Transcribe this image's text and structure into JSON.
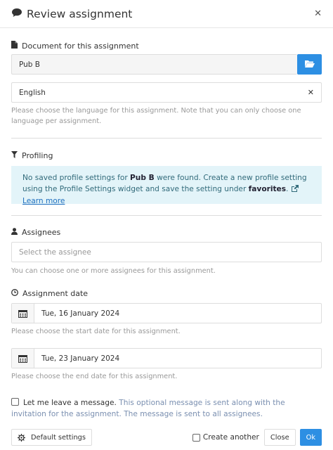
{
  "dialog": {
    "title": "Review assignment",
    "title_icon": "comment-icon",
    "close_icon": "close-icon"
  },
  "document": {
    "label": "Document for this assignment",
    "label_icon": "file-icon",
    "value": "Pub B",
    "browse_icon": "folder-open-icon"
  },
  "language": {
    "value": "English",
    "clear_icon": "close-icon",
    "hint": "Please choose the language for this assignment. Note that you can only choose one language per assignment."
  },
  "profiling": {
    "label": "Profiling",
    "label_icon": "filter-icon",
    "info": {
      "text_before": "No saved profile settings for ",
      "doc_name": "Pub B",
      "text_middle": " were found. Create a new profile setting using the Profile Settings widget and save the setting under ",
      "favorites": "favorites",
      "text_after": ". ",
      "learn_more": "Learn more",
      "external_icon": "external-link-icon"
    }
  },
  "assignees": {
    "label": "Assignees",
    "label_icon": "user-icon",
    "placeholder": "Select the assignee",
    "hint": "You can choose one or more assignees for this assignment."
  },
  "assignment_date": {
    "label": "Assignment date",
    "label_icon": "clock-icon",
    "start_value": "Tue, 16 January 2024",
    "start_hint": "Please choose the start date for this assignment.",
    "end_value": "Tue, 23 January 2024",
    "end_hint": "Please choose the end date for this assignment.",
    "calendar_icon": "calendar-icon"
  },
  "message": {
    "checked": false,
    "label": "Let me leave a message.",
    "hint": " This optional message is sent along with the invitation for the assignment. The message is sent to all assignees."
  },
  "footer": {
    "default_settings": "Default settings",
    "default_settings_icon": "gear-icon",
    "create_another": "Create another",
    "create_another_checked": false,
    "close": "Close",
    "ok": "Ok"
  },
  "colors": {
    "primary": "#2d8fe3",
    "info_bg": "#e3f4f9",
    "info_text": "#316a7a",
    "hint": "#999999",
    "link": "#1f6fbf",
    "message_hint": "#7a8fb0"
  }
}
